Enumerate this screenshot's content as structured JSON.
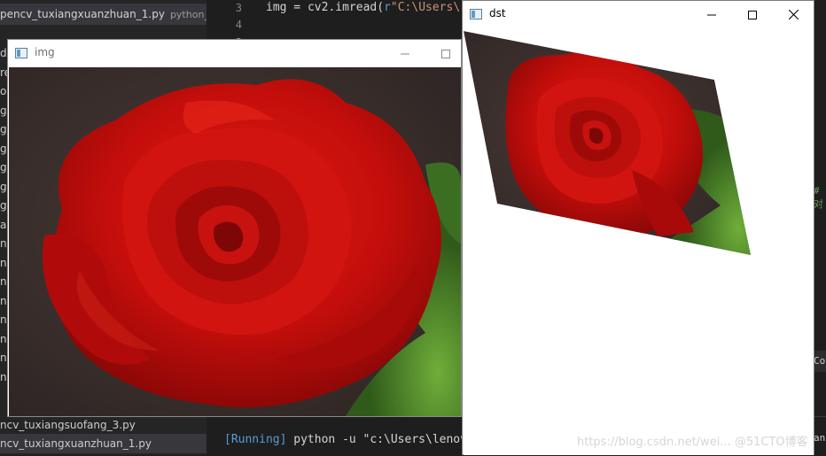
{
  "ide": {
    "explorer": {
      "top_tab": {
        "name": "pencv_tuxiangxuanzhuan_1.py",
        "desc": "python_..."
      },
      "gutter_letters": [
        "de",
        "re",
        "or",
        "g(",
        "g(",
        "ge",
        "g(",
        "g(",
        "g(",
        "ac",
        "nc",
        "nc",
        "nc",
        "nc",
        "nc",
        "nc",
        "nc",
        "nc"
      ],
      "files": [
        {
          "name": "ncv_tuxiangsuofang_3.py",
          "active": false
        },
        {
          "name": "ncv_tuxiangxuanzhuan_1.py",
          "active": true
        }
      ]
    },
    "editor": {
      "lines": [
        {
          "number": "3",
          "code": "img = cv2.imread(",
          "prefix": "r",
          "string": "\"C:\\Users\\"
        },
        {
          "number": "4",
          "code": "",
          "prefix": "",
          "string": ""
        },
        {
          "number": "5",
          "code": "",
          "prefix": "",
          "string": ""
        }
      ]
    },
    "terminal": {
      "running": "[Running]",
      "command": "python -u \"c:\\Users\\lenov"
    },
    "right_hints": {
      "comment": "#对",
      "co": "Co",
      "an": "an"
    }
  },
  "windows": {
    "img": {
      "title": "img",
      "minimize_label": "—",
      "maximize_label": "☐"
    },
    "dst": {
      "title": "dst",
      "minimize_label": "—",
      "maximize_label": "☐",
      "close_label": "✕",
      "watermark": "https://blog.csdn.net/wei... @51CTO博客"
    }
  },
  "colors": {
    "ide_bg": "#1e1e1e",
    "explorer_bg": "#252526",
    "rose_red": "#c8100f",
    "rose_dark": "#7a0606",
    "leaf_green": "#4e8a2a",
    "photo_bg": "#3a3230"
  }
}
